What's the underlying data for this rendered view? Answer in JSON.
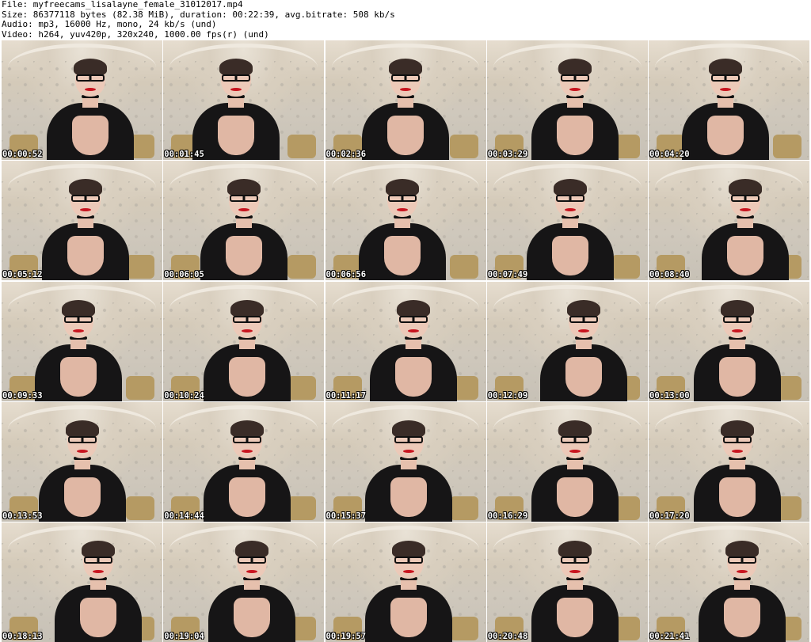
{
  "header": {
    "line_file": "File: myfreecams_lisalayne_female_31012017.mp4",
    "line_size": "Size: 86377118 bytes (82.38 MiB), duration: 00:22:39, avg.bitrate: 508 kb/s",
    "line_audio": "Audio: mp3, 16000 Hz, mono, 24 kb/s (und)",
    "line_video": "Video: h264, yuv420p, 320x240, 1000.00 fps(r) (und)"
  },
  "thumbnails": [
    {
      "timestamp": "00:00:52"
    },
    {
      "timestamp": "00:01:45"
    },
    {
      "timestamp": "00:02:36"
    },
    {
      "timestamp": "00:03:29"
    },
    {
      "timestamp": "00:04:20"
    },
    {
      "timestamp": "00:05:12"
    },
    {
      "timestamp": "00:06:05"
    },
    {
      "timestamp": "00:06:56"
    },
    {
      "timestamp": "00:07:49"
    },
    {
      "timestamp": "00:08:40"
    },
    {
      "timestamp": "00:09:33"
    },
    {
      "timestamp": "00:10:24"
    },
    {
      "timestamp": "00:11:17"
    },
    {
      "timestamp": "00:12:09"
    },
    {
      "timestamp": "00:13:00"
    },
    {
      "timestamp": "00:13:53"
    },
    {
      "timestamp": "00:14:44"
    },
    {
      "timestamp": "00:15:37"
    },
    {
      "timestamp": "00:16:29"
    },
    {
      "timestamp": "00:17:20"
    },
    {
      "timestamp": "00:18:13"
    },
    {
      "timestamp": "00:19:04"
    },
    {
      "timestamp": "00:19:57"
    },
    {
      "timestamp": "00:20:48"
    },
    {
      "timestamp": "00:21:41"
    }
  ]
}
